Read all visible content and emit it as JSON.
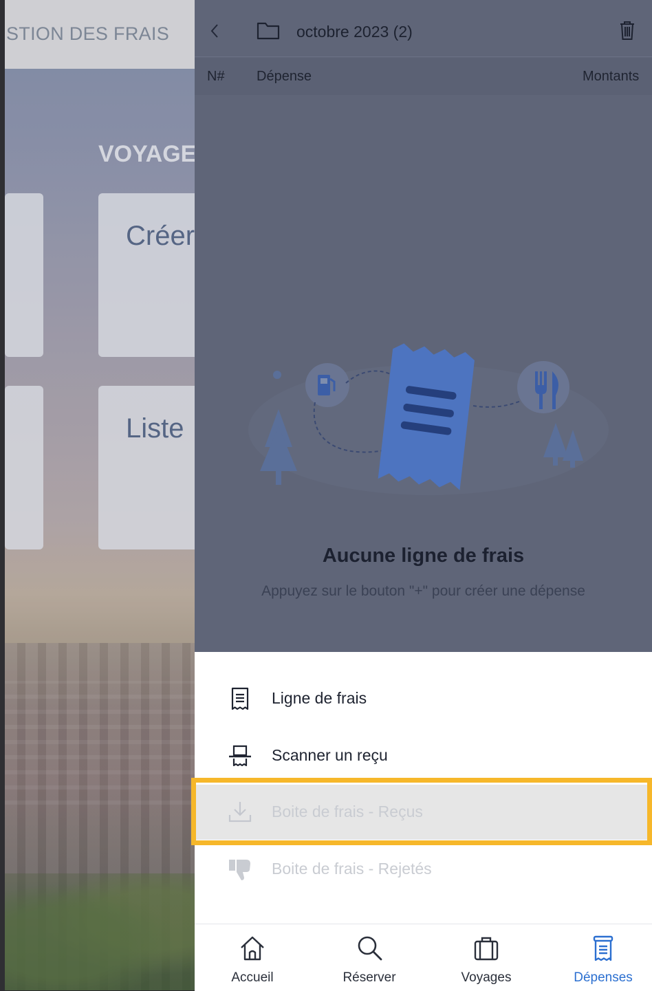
{
  "left_app": {
    "header_title": "STION DES FRAIS",
    "section_title": "VOYAGE",
    "card_create": "Créer",
    "card_list": "Liste"
  },
  "panel": {
    "folder_title": "octobre 2023 (2)",
    "columns": {
      "number": "N#",
      "expense": "Dépense",
      "amounts": "Montants"
    },
    "empty_title": "Aucune ligne de frais",
    "empty_subtitle": "Appuyez sur le bouton \"+\" pour créer une dépense"
  },
  "sheet": {
    "items": [
      {
        "label": "Ligne de frais",
        "icon": "receipt-icon",
        "enabled": true
      },
      {
        "label": "Scanner un reçu",
        "icon": "scanner-icon",
        "enabled": true
      },
      {
        "label": "Boite de frais - Reçus",
        "icon": "download-icon",
        "enabled": false,
        "highlighted": true
      },
      {
        "label": "Boite de frais - Rejetés",
        "icon": "thumbs-down-icon",
        "enabled": false
      }
    ]
  },
  "nav": {
    "items": [
      {
        "label": "Accueil",
        "icon": "home-icon"
      },
      {
        "label": "Réserver",
        "icon": "search-icon"
      },
      {
        "label": "Voyages",
        "icon": "suitcase-icon"
      },
      {
        "label": "Dépenses",
        "icon": "expenses-icon",
        "active": true
      }
    ]
  },
  "colors": {
    "accent": "#2b6fd0",
    "highlight_border": "#f6b72a",
    "overlay": "#5f6578"
  }
}
